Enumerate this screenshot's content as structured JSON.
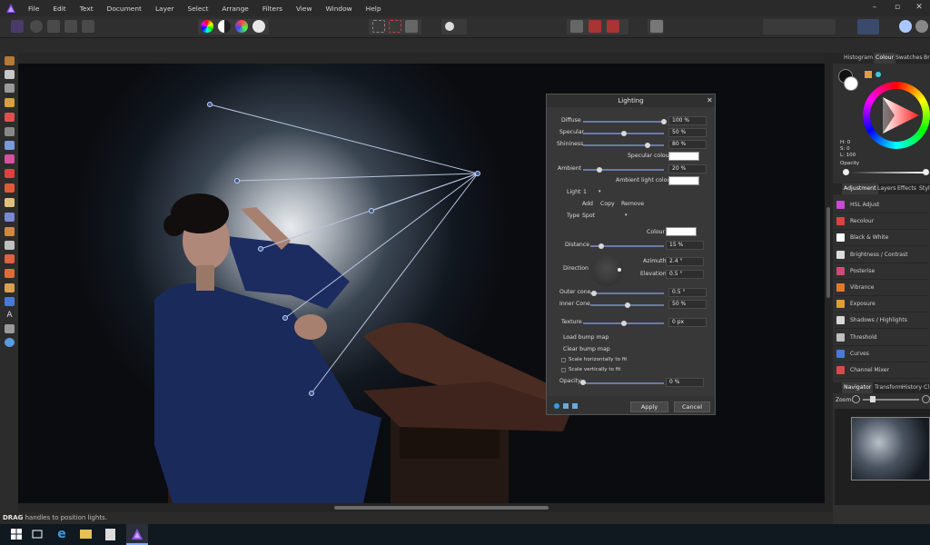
{
  "menu": [
    "File",
    "Edit",
    "Text",
    "Document",
    "Layer",
    "Select",
    "Arrange",
    "Filters",
    "View",
    "Window",
    "Help"
  ],
  "status": {
    "bold": "DRAG",
    "text": "handles to position lights."
  },
  "right_tabs_top": [
    "Histogram",
    "Colour",
    "Swatches",
    "Br"
  ],
  "colour_readout": {
    "h": "H: 0",
    "s": "S: 0",
    "l": "L: 100",
    "opacity_label": "Opacity"
  },
  "right_tabs_mid": [
    "Adjustment",
    "Layers",
    "Effects",
    "Styl"
  ],
  "adjustments": [
    {
      "label": "HSL Adjust",
      "color": "#c84bd0"
    },
    {
      "label": "Recolour",
      "color": "#e04040"
    },
    {
      "label": "Black & White",
      "color": "#ffffff"
    },
    {
      "label": "Brightness / Contrast",
      "color": "#dcdcdc"
    },
    {
      "label": "Posterise",
      "color": "#d24878"
    },
    {
      "label": "Vibrance",
      "color": "#e07a2a"
    },
    {
      "label": "Exposure",
      "color": "#e0a030"
    },
    {
      "label": "Shadows / Highlights",
      "color": "#d8d8d8"
    },
    {
      "label": "Threshold",
      "color": "#bfbfbf"
    },
    {
      "label": "Curves",
      "color": "#4a7ad8"
    },
    {
      "label": "Channel Mixer",
      "color": "#d84a4a"
    }
  ],
  "right_tabs_bottom": [
    "Navigator",
    "Transform",
    "History",
    "Cl"
  ],
  "zoom_label": "Zoom:",
  "dialog": {
    "title": "Lighting",
    "diffuse": {
      "label": "Diffuse",
      "value": "100 %",
      "level": 1.0
    },
    "specular": {
      "label": "Specular",
      "value": "50 %",
      "level": 0.5
    },
    "shininess": {
      "label": "Shininess",
      "value": "80 %",
      "level": 0.8
    },
    "specular_colour": "Specular colour",
    "ambient": {
      "label": "Ambient",
      "value": "20 %",
      "level": 0.2
    },
    "ambient_colour": "Ambient light colour",
    "light_label": "Light",
    "light_value": "1",
    "add": "Add",
    "copy": "Copy",
    "remove": "Remove",
    "type_label": "Type",
    "type_value": "Spot",
    "colour_label": "Colour",
    "distance": {
      "label": "Distance",
      "value": "15 %",
      "level": 0.15
    },
    "direction_label": "Direction",
    "azimuth_label": "Azimuth",
    "azimuth_value": "2.4 °",
    "elevation_label": "Elevation",
    "elevation_value": "0.5 °",
    "outer_cone": {
      "label": "Outer cone",
      "value": "0.5 °",
      "level": 0.05
    },
    "inner_cone": {
      "label": "Inner Cone",
      "value": "50 %",
      "level": 0.5
    },
    "texture": {
      "label": "Texture",
      "value": "0 px",
      "level": 0.5
    },
    "load_bump": "Load bump map",
    "clear_bump": "Clear bump map",
    "scale_h": "Scale horizontally to fit",
    "scale_v": "Scale vertically to fit",
    "opacity": {
      "label": "Opacity",
      "value": "0 %",
      "level": 0.0
    },
    "apply": "Apply",
    "cancel": "Cancel"
  }
}
